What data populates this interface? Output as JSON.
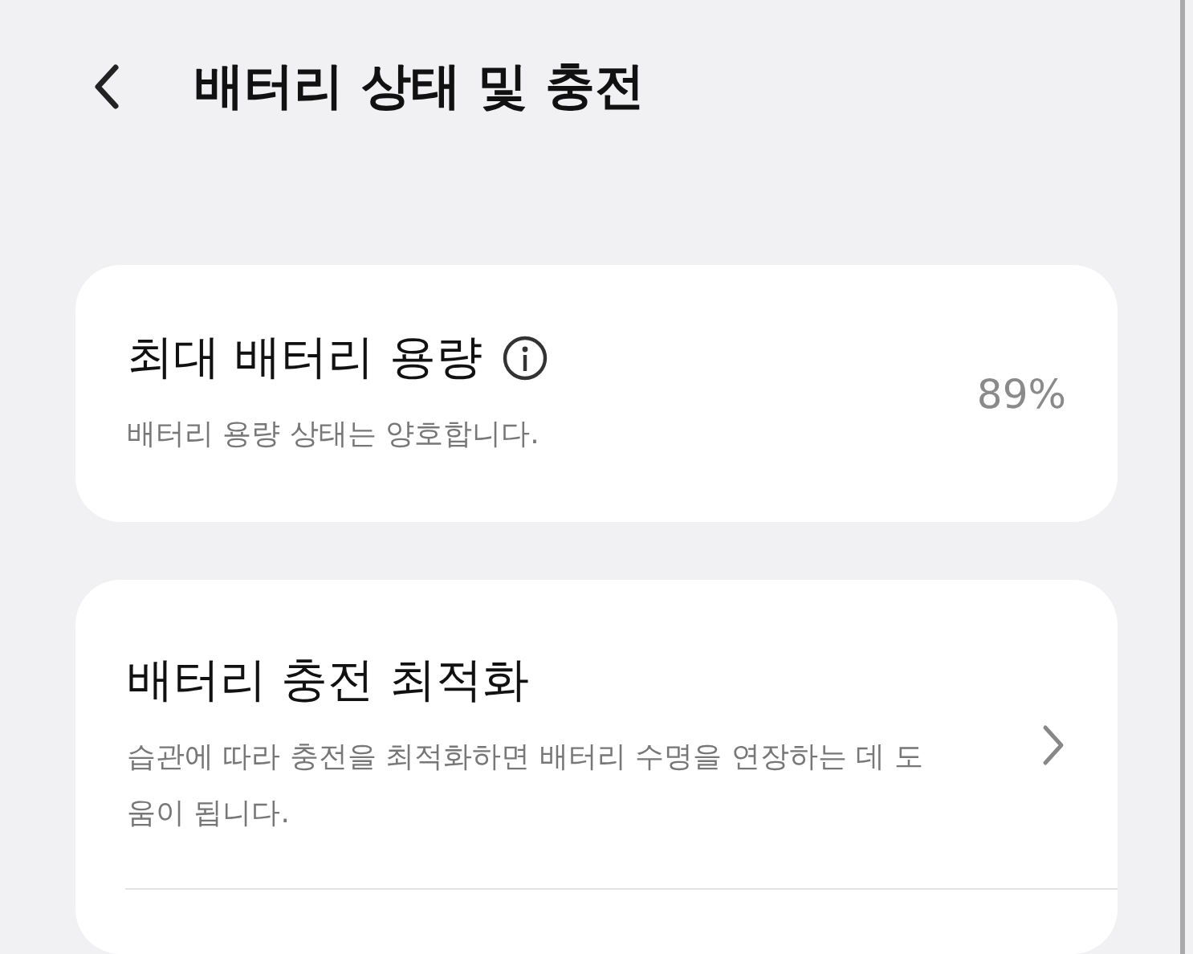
{
  "header": {
    "title": "배터리 상태 및 충전"
  },
  "capacity_card": {
    "title": "최대 배터리 용량",
    "subtitle": "배터리 용량 상태는 양호합니다.",
    "value": "89%"
  },
  "optimize_card": {
    "title": "배터리 충전 최적화",
    "description": "습관에 따라 충전을 최적화하면 배터리 수명을 연장하는 데 도움이 됩니다."
  }
}
